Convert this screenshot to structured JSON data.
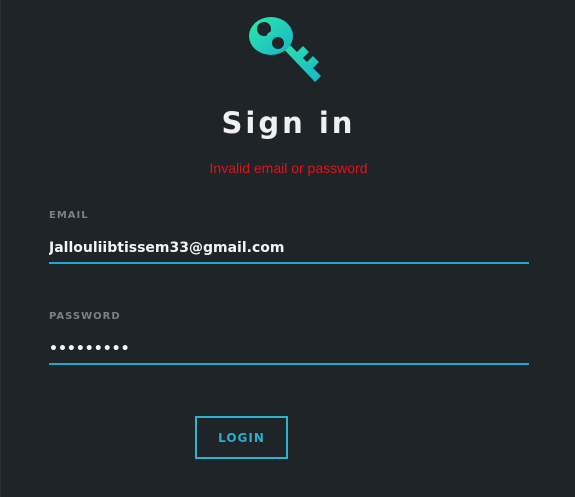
{
  "header": {
    "icon": "key-icon",
    "title": "Sign in"
  },
  "error_message": "Invalid email or password",
  "form": {
    "email": {
      "label": "EMAIL",
      "value": "Jallouliibtissem33@gmail.com"
    },
    "password": {
      "label": "PASSWORD",
      "value": "•••••••••"
    },
    "login_label": "LOGIN"
  },
  "colors": {
    "background": "#1e2428",
    "accent": "#23a8cf",
    "error": "#e3121b",
    "icon_gradient_start": "#2ee8a6",
    "icon_gradient_end": "#14b6c9"
  }
}
